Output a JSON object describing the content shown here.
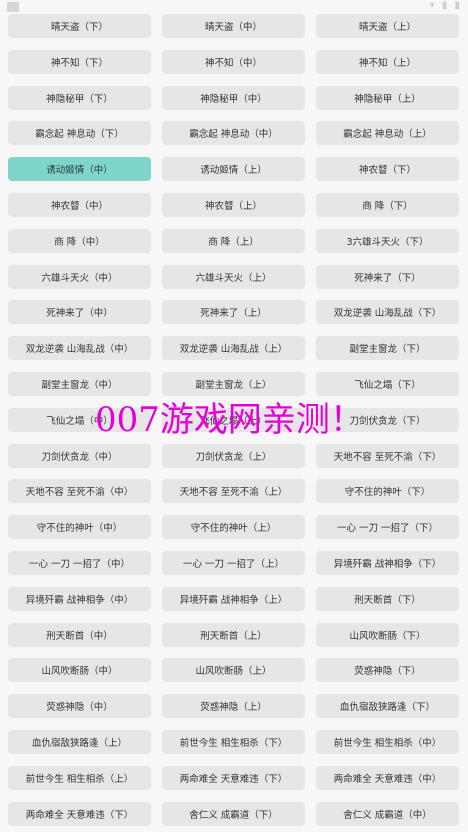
{
  "buttons": [
    "晴天盗（下）",
    "晴天盗（中）",
    "晴天盗（上）",
    "神不知（下）",
    "神不知（中）",
    "神不知（上）",
    "神隐秘甲（下）",
    "神隐秘甲（中）",
    "神隐秘甲（上）",
    "霸念起 神息动（下）",
    "霸念起 神息动（中）",
    "霸念起 神息动（上）",
    "诱动姬情（中）",
    "诱动姬情（上）",
    "神农瞽（下）",
    "神农瞽（中）",
    "神农瞽（上）",
    "商 降（下）",
    "商 降（中）",
    "商 降（上）",
    "3六雄斗天火（下）",
    "六雄斗天火（中）",
    "六雄斗天火（上）",
    "死神来了（下）",
    "死神来了（中）",
    "死神来了（上）",
    "双龙逆袭 山海乱战（下）",
    "双龙逆袭 山海乱战（中）",
    "双龙逆袭 山海乱战（上）",
    "副堂主窗龙（下）",
    "副堂主窗龙（中）",
    "副堂主窗龙（上）",
    "飞仙之塌（下）",
    "飞仙之塌（中）",
    "飞仙之塌（上）",
    "刀剑伏贪龙（下）",
    "刀剑伏贪龙（中）",
    "刀剑伏贪龙（上）",
    "天地不容 至死不渝（下）",
    "天地不容 至死不渝（中）",
    "天地不容 至死不渝（上）",
    "守不住的神叶（下）",
    "守不住的神叶（中）",
    "守不住的神叶（上）",
    "一心 一刀 一招了（下）",
    "一心 一刀 一招了（中）",
    "一心 一刀 一招了（上）",
    "异境歼霸 战神相争（下）",
    "异境歼霸 战神相争（中）",
    "异境歼霸 战神相争（上）",
    "刑天断首（下）",
    "刑天断首（中）",
    "刑天断首（上）",
    "山风吹断肠（下）",
    "山风吹断肠（中）",
    "山风吹断肠（上）",
    "荧惑神隐（下）",
    "荧惑神隐（中）",
    "荧惑神隐（上）",
    "血仇宿敌狭路逢（下）",
    "血仇宿敌狭路逢（上）",
    "前世今生 相生相杀（下）",
    "前世今生 相生相杀（中）",
    "前世今生 相生相杀（上）",
    "两命难全 天意难违（下）",
    "两命难全 天意难违（中）",
    "两命难全 天意难违（下）",
    "舍仁义 成霸道（下）",
    "舍仁义 成霸道（中）"
  ],
  "active_index": 12,
  "watermark": "007游戏网亲测！",
  "colors": {
    "active_bg": "#7fd5c9",
    "button_bg": "#e6e6e6",
    "watermark": "#e600d8"
  }
}
